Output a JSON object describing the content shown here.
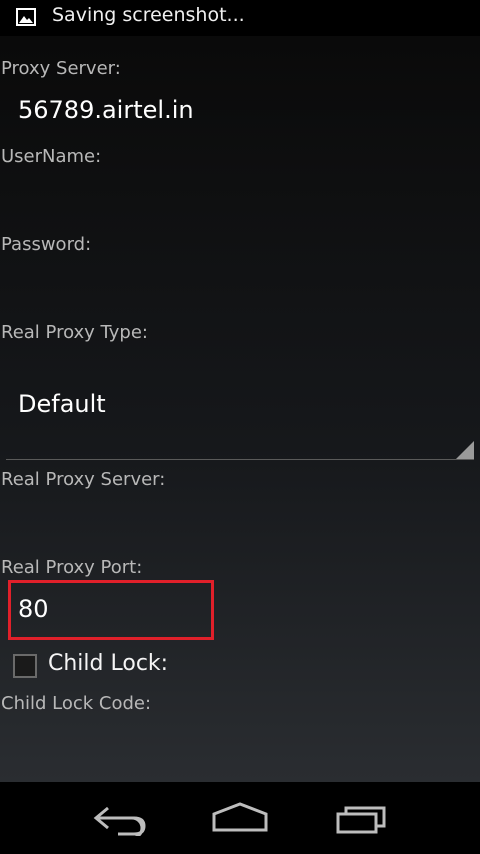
{
  "status_bar": {
    "notification_icon": "image-icon",
    "notification_text": "Saving screenshot..."
  },
  "form": {
    "proxy_server_label": "Proxy Server:",
    "proxy_server_value": "56789.airtel.in",
    "username_label": "UserName:",
    "username_value": "",
    "password_label": "Password:",
    "password_value": "",
    "real_proxy_type_label": "Real Proxy Type:",
    "real_proxy_type_value": "Default",
    "real_proxy_server_label": "Real Proxy Server:",
    "real_proxy_server_value": "",
    "real_proxy_port_label": "Real Proxy Port:",
    "real_proxy_port_value": "80",
    "child_lock_label": "Child Lock:",
    "child_lock_checked": false,
    "child_lock_code_label": "Child Lock Code:",
    "child_lock_code_value": ""
  },
  "highlight": {
    "color": "#e0202a"
  },
  "nav_bar": {
    "back_icon": "back-icon",
    "home_icon": "home-icon",
    "recents_icon": "recent-apps-icon"
  }
}
